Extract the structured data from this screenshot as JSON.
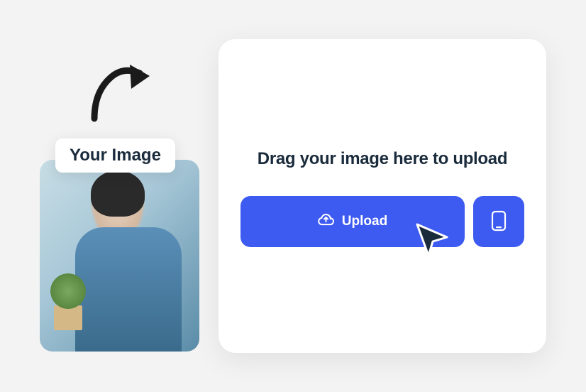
{
  "label": {
    "text": "Your Image"
  },
  "panel": {
    "heading": "Drag  your image here to upload",
    "upload_button_label": "Upload"
  },
  "colors": {
    "primary": "#3d5af1",
    "text_dark": "#1a2b3c",
    "background": "#f3f3f3",
    "panel_bg": "#ffffff"
  },
  "icons": {
    "upload": "cloud-upload-icon",
    "mobile": "phone-icon",
    "arrow": "curved-arrow-icon",
    "cursor": "cursor-pointer-icon"
  }
}
